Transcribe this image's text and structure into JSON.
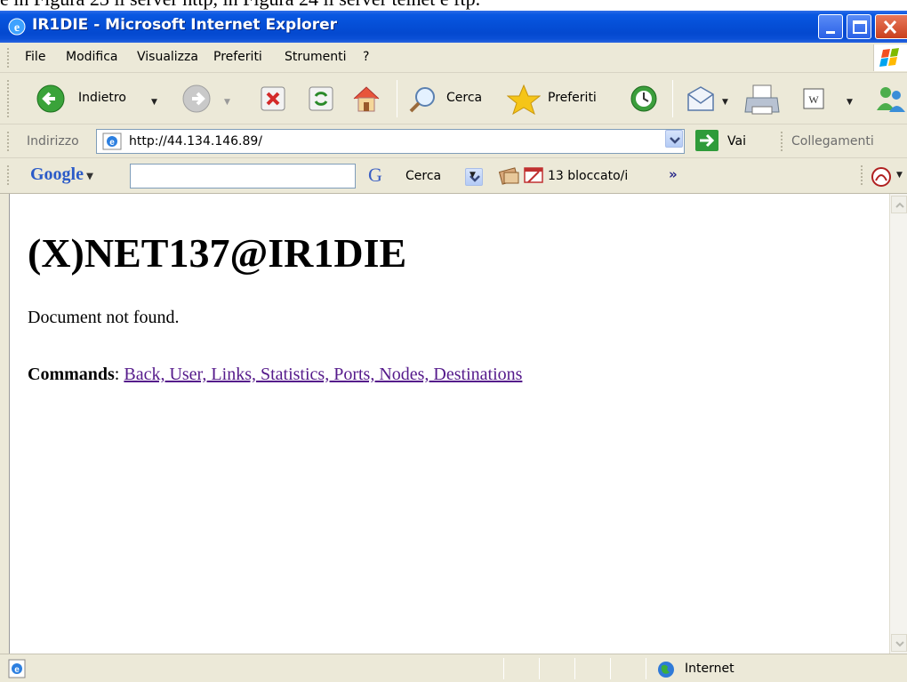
{
  "caption": {
    "text": "e in Figura 23 il server http, in Figura 24 il server telnet e ftp."
  },
  "window": {
    "title": "IR1DIE - Microsoft Internet Explorer"
  },
  "menu": {
    "items": [
      "File",
      "Modifica",
      "Visualizza",
      "Preferiti",
      "Strumenti",
      "?"
    ]
  },
  "toolbar": {
    "back_label": "Indietro",
    "search_label": "Cerca",
    "favorites_label": "Preferiti"
  },
  "address": {
    "label": "Indirizzo",
    "url": "http://44.134.146.89/",
    "go_label": "Vai",
    "links_label": "Collegamenti"
  },
  "google": {
    "logo": "Google",
    "search_value": "",
    "search_label": "Cerca",
    "blocked_label": "13 bloccato/i",
    "more": "»"
  },
  "page": {
    "heading": "(X)NET137@IR1DIE",
    "message": "Document not found.",
    "commands_label": "Commands",
    "commands_links": "Back, User, Links, Statistics, Ports, Nodes, Destinations"
  },
  "status": {
    "zone": "Internet"
  },
  "colors": {
    "titlebar": "#0550d8",
    "visited_link": "#551a8b",
    "chrome": "#ece9d8"
  }
}
